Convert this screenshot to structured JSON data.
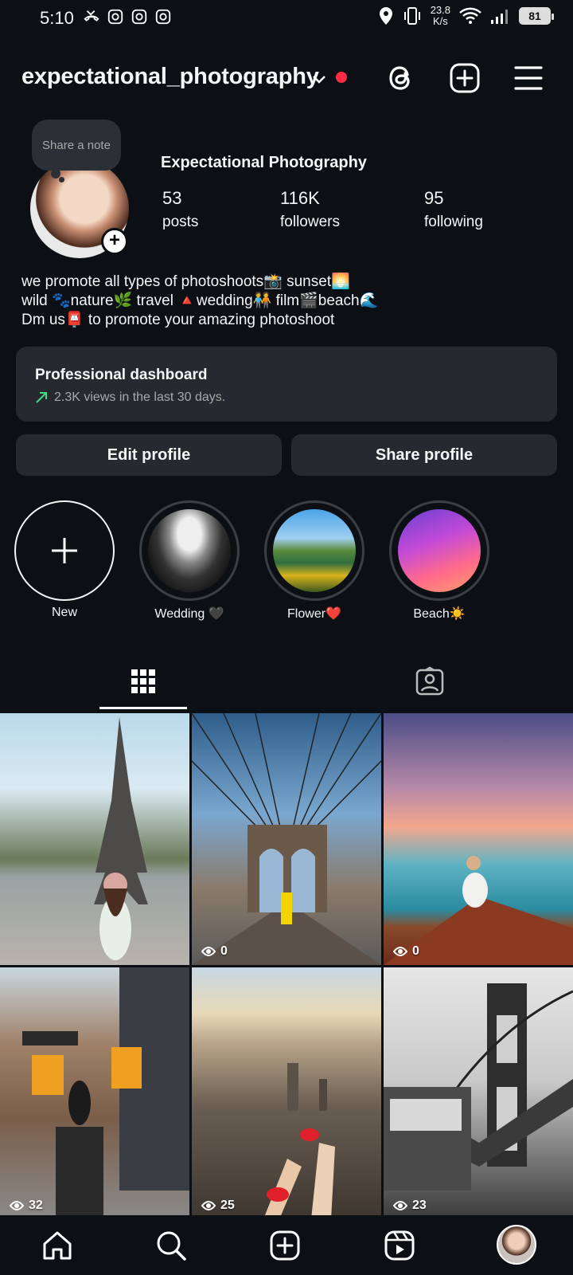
{
  "status_bar": {
    "time": "5:10",
    "net_speed_value": "23.8",
    "net_speed_unit": "K/s",
    "battery": "81"
  },
  "header": {
    "username": "expectational_photography"
  },
  "profile": {
    "note_placeholder": "Share a note",
    "display_name": "Expectational Photography",
    "stats": [
      {
        "value": "53",
        "label": "posts"
      },
      {
        "value": "116K",
        "label": "followers"
      },
      {
        "value": "95",
        "label": "following"
      }
    ],
    "bio": [
      "we promote all types of photoshoots📸 sunset🌅",
      "wild 🐾nature🌿 travel 🔺wedding🧑‍🤝‍🧑 film🎬beach🌊",
      "Dm us📮 to promote your amazing photoshoot"
    ]
  },
  "dashboard": {
    "title": "Professional dashboard",
    "subtitle": "2.3K views in the last 30 days."
  },
  "buttons": {
    "edit": "Edit profile",
    "share": "Share profile"
  },
  "highlights": [
    {
      "label": "New"
    },
    {
      "label": "Wedding 🖤"
    },
    {
      "label": "Flower❤️"
    },
    {
      "label": "Beach☀️"
    }
  ],
  "posts": [
    {
      "views": ""
    },
    {
      "views": "0"
    },
    {
      "views": "0"
    },
    {
      "views": "32"
    },
    {
      "views": "25"
    },
    {
      "views": "23"
    }
  ],
  "colors": {
    "background": "#0c1014",
    "card": "#262a30",
    "notification_dot": "#ff2b45",
    "trend_green": "#3ddc84"
  }
}
